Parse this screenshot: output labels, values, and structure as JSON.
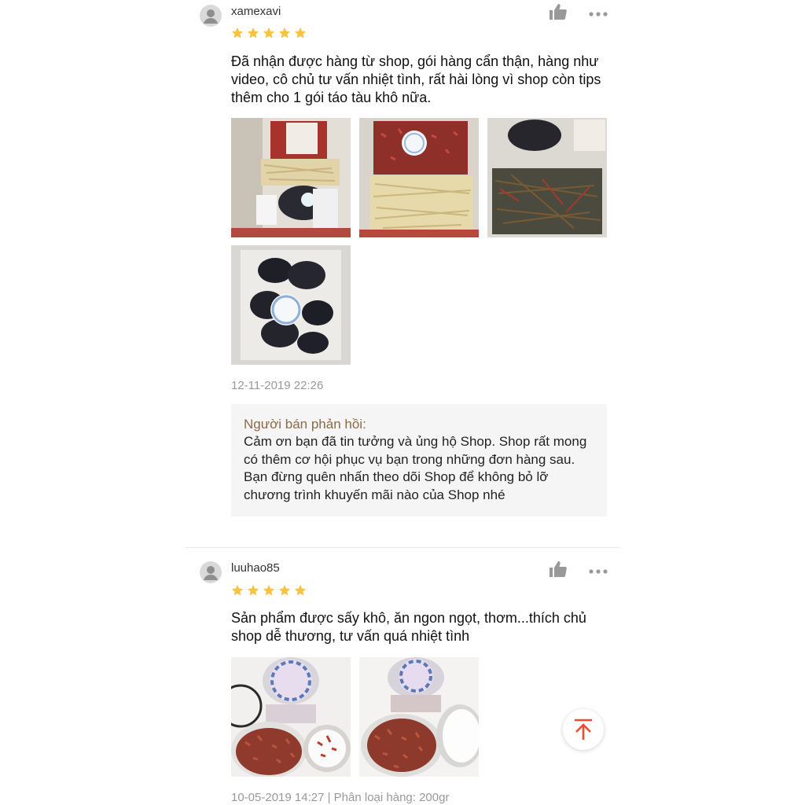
{
  "reviews": [
    {
      "username": "xamexavi",
      "rating": 5,
      "comment": "Đã nhận được hàng từ shop, gói hàng cẩn thận, hàng như video, cô chủ tư vấn nhiệt tình, rất hài lòng vì shop còn tips thêm cho 1 gói táo tàu khô nữa.",
      "photos": [
        "review-photo-1",
        "review-photo-2",
        "review-photo-3",
        "review-photo-4"
      ],
      "timestamp": "12-11-2019 22:26",
      "seller_reply": {
        "label": "Người bán phản hồi:",
        "text": "Cảm ơn bạn đã tin tưởng và ủng hộ Shop. Shop rất mong có thêm cơ hội phục vụ bạn trong những đơn hàng sau. Bạn đừng quên nhấn theo dõi Shop để không bỏ lỡ chương trình khuyến mãi nào của Shop nhé"
      }
    },
    {
      "username": "luuhao85",
      "rating": 5,
      "comment": "Sản phẩm được sấy khô, ăn ngon ngọt, thơm...thích chủ shop dễ thương, tư vấn quá nhiệt tình",
      "photos": [
        "review-photo-1",
        "review-photo-2"
      ],
      "timestamp": "10-05-2019 14:27 | Phân loại hàng: 200gr"
    }
  ],
  "icons": {
    "avatar": "user-avatar-icon",
    "like": "thumbs-up-icon",
    "more": "more-options-icon",
    "star": "star-icon",
    "scroll_top": "scroll-to-top-icon"
  },
  "colors": {
    "star": "#f6c342",
    "accent": "#ee4d2d",
    "seller_label": "#8a6a4a",
    "muted": "#999999"
  }
}
